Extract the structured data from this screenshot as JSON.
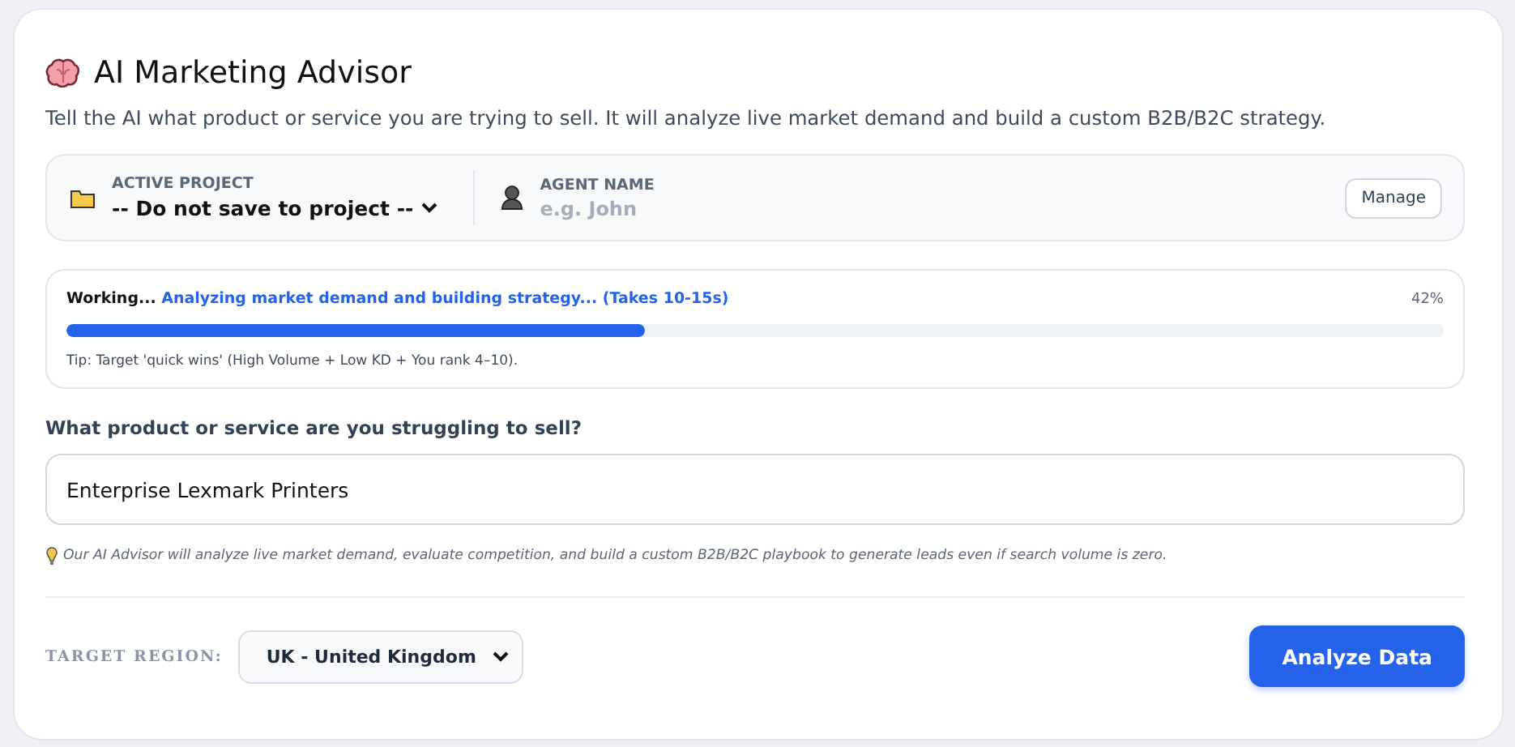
{
  "header": {
    "title": "AI Marketing Advisor",
    "description": "Tell the AI what product or service you are trying to sell. It will analyze live market demand and build a custom B2B/B2C strategy."
  },
  "project_bar": {
    "project_label": "ACTIVE PROJECT",
    "project_value": "-- Do not save to project --",
    "agent_label": "AGENT NAME",
    "agent_placeholder": "e.g. John",
    "manage_button": "Manage"
  },
  "progress": {
    "status": "Working...",
    "message": "Analyzing market demand and building strategy... (Takes 10-15s)",
    "percent": "42%",
    "level": 0.42,
    "tip": "Tip: Target 'quick wins' (High Volume + Low KD + You rank 4–10)."
  },
  "question": {
    "label": "What product or service are you struggling to sell?",
    "value": "Enterprise Lexmark Printers",
    "hint": "Our AI Advisor will analyze live market demand, evaluate competition, and build a custom B2B/B2C playbook to generate leads even if search volume is zero."
  },
  "footer": {
    "region_label": "TARGET REGION:",
    "region_value": "UK - United Kingdom",
    "submit_button": "Analyze Data"
  }
}
